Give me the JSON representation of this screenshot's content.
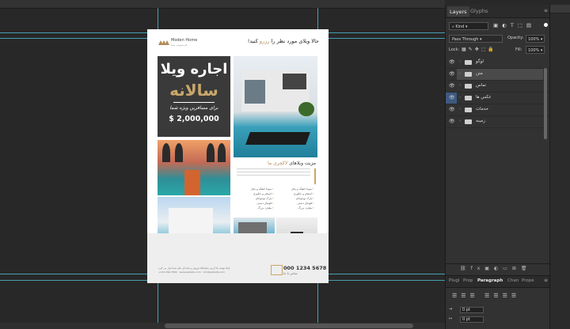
{
  "document": {
    "brand_name": "Moden Home",
    "brand_sub": "نام مجموعه شما",
    "tagline_prefix": "حالا ویلای مورد نظر را",
    "tagline_highlight": "رزرو",
    "tagline_suffix": "کنید!",
    "headline_1": "اجاره ویلا",
    "headline_2": "سالانه",
    "subtitle": "برای مسافرین ویژه شما",
    "price": "$ 2,000,000",
    "features_title_prefix": "مزیت ویلاهای",
    "features_title_highlight": "لاکچری ما",
    "features": [
      "سونا خشک و بخار",
      "سونا خشک و بخار",
      "استخر و جکوزی",
      "استخر و جکوزی",
      "پارک نوجوانان",
      "پارک نوجوانان",
      "فوتبال دستی",
      "فوتبال دستی",
      "بیلیارد بزرگ",
      "بیلیارد بزرگ"
    ],
    "phone": "000 1234 5678",
    "phone_sub": "تماس با ما",
    "contact_address": "اینجا نوشته ها آدرس نمایشگاه فروش و نمایندگی های شما قرار می گیرد",
    "contact_phone": "+123-456-7890",
    "contact_site": "www.website.com",
    "contact_email": "info@website.com"
  },
  "layers_panel": {
    "tabs": [
      "Layers",
      "Glyphs"
    ],
    "kind_label": "Kind",
    "blend_mode": "Pass Through",
    "opacity_label": "Opacity:",
    "opacity_value": "100%",
    "lock_label": "Lock:",
    "fill_label": "Fill:",
    "fill_value": "100%",
    "layers": [
      {
        "name": "لوگو",
        "eye_highlight": false,
        "selected": false
      },
      {
        "name": "متن",
        "eye_highlight": false,
        "selected": true
      },
      {
        "name": "تماس",
        "eye_highlight": false,
        "selected": false
      },
      {
        "name": "عکس ها",
        "eye_highlight": true,
        "selected": false
      },
      {
        "name": "خدمات",
        "eye_highlight": false,
        "selected": false
      },
      {
        "name": "زمینه",
        "eye_highlight": false,
        "selected": false
      }
    ]
  },
  "paragraph_panel": {
    "tabs": [
      "Plugi",
      "Prop",
      "Paragraph",
      "Chan",
      "Prope"
    ],
    "indent_1": "0 pt",
    "indent_2": "0 pt"
  }
}
